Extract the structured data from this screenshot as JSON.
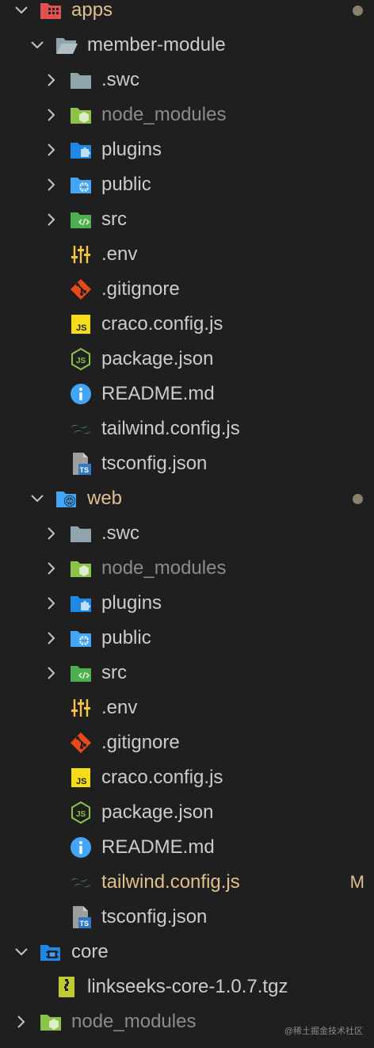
{
  "colors": {
    "background": "#1f1f1f",
    "text": "#cccccc",
    "dimmed": "#8b8b8b",
    "modified": "#e2c08d",
    "folder_apps": "#e05252",
    "folder_blue": "#42a5f5",
    "folder_green": "#8bc34a",
    "folder_grey": "#90a4ae",
    "git": "#e64a19",
    "js": "#f5de19",
    "node": "#8bc34a",
    "info": "#42a5f5",
    "tailwind": "#4db6ac",
    "ts": "#3178c6"
  },
  "tree": {
    "apps": {
      "label": "apps",
      "icon": "folder-apps-open-icon"
    },
    "member_module": {
      "label": "member-module",
      "icon": "folder-open-icon",
      "children": [
        {
          "label": ".swc",
          "icon": "folder-grey-icon",
          "kind": "folder"
        },
        {
          "label": "node_modules",
          "icon": "folder-node-icon",
          "kind": "folder",
          "dim": true
        },
        {
          "label": "plugins",
          "icon": "folder-plugin-icon",
          "kind": "folder"
        },
        {
          "label": "public",
          "icon": "folder-public-icon",
          "kind": "folder"
        },
        {
          "label": "src",
          "icon": "folder-src-icon",
          "kind": "folder"
        },
        {
          "label": ".env",
          "icon": "env-sliders-icon",
          "kind": "file"
        },
        {
          "label": ".gitignore",
          "icon": "git-icon",
          "kind": "file"
        },
        {
          "label": "craco.config.js",
          "icon": "js-icon",
          "kind": "file"
        },
        {
          "label": "package.json",
          "icon": "nodejs-icon",
          "kind": "file"
        },
        {
          "label": "README.md",
          "icon": "info-icon",
          "kind": "file"
        },
        {
          "label": "tailwind.config.js",
          "icon": "tailwind-icon",
          "kind": "file"
        },
        {
          "label": "tsconfig.json",
          "icon": "tsconfig-icon",
          "kind": "file"
        }
      ]
    },
    "web": {
      "label": "web",
      "icon": "folder-web-open-icon",
      "children": [
        {
          "label": ".swc",
          "icon": "folder-grey-icon",
          "kind": "folder"
        },
        {
          "label": "node_modules",
          "icon": "folder-node-icon",
          "kind": "folder",
          "dim": true
        },
        {
          "label": "plugins",
          "icon": "folder-plugin-icon",
          "kind": "folder"
        },
        {
          "label": "public",
          "icon": "folder-public-icon",
          "kind": "folder"
        },
        {
          "label": "src",
          "icon": "folder-src-icon",
          "kind": "folder"
        },
        {
          "label": ".env",
          "icon": "env-sliders-icon",
          "kind": "file"
        },
        {
          "label": ".gitignore",
          "icon": "git-icon",
          "kind": "file"
        },
        {
          "label": "craco.config.js",
          "icon": "js-icon",
          "kind": "file"
        },
        {
          "label": "package.json",
          "icon": "nodejs-icon",
          "kind": "file"
        },
        {
          "label": "README.md",
          "icon": "info-icon",
          "kind": "file"
        },
        {
          "label": "tailwind.config.js",
          "icon": "tailwind-icon",
          "kind": "file",
          "modified": true,
          "badge": "M"
        },
        {
          "label": "tsconfig.json",
          "icon": "tsconfig-icon",
          "kind": "file"
        }
      ]
    },
    "core": {
      "label": "core",
      "icon": "folder-core-open-icon",
      "children": [
        {
          "label": "linkseeks-core-1.0.7.tgz",
          "icon": "archive-icon",
          "kind": "file"
        }
      ]
    },
    "node_modules_root": {
      "label": "node_modules",
      "icon": "folder-node-icon",
      "dim": true
    }
  },
  "watermark": "@稀土掘金技术社区"
}
